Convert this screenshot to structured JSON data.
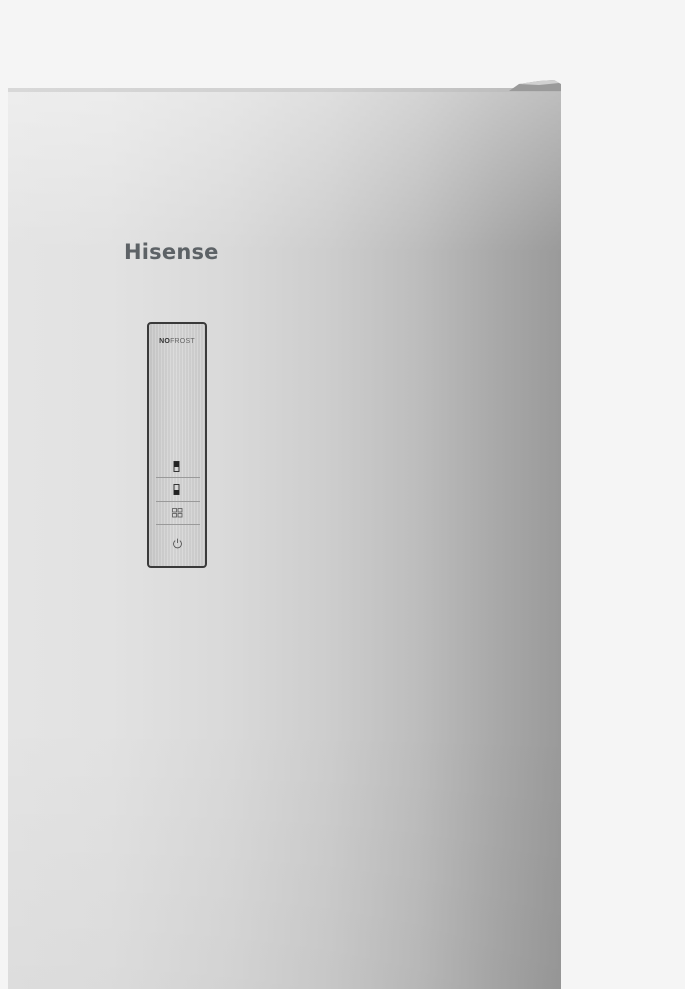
{
  "photo": {
    "brand": "Hisense",
    "control_panel": {
      "badge_bold": "NO",
      "badge_rest": "FROST",
      "buttons": [
        {
          "icon": "fridge-compartment-icon"
        },
        {
          "icon": "freezer-compartment-icon"
        },
        {
          "icon": "mode-grid-icon"
        },
        {
          "icon": "power-icon"
        }
      ]
    }
  }
}
